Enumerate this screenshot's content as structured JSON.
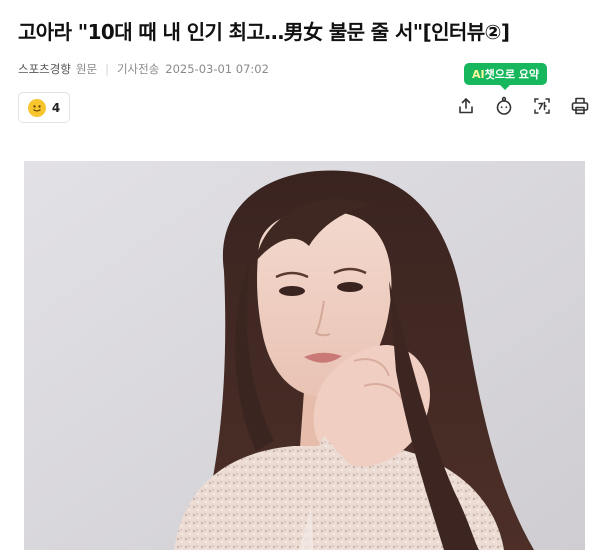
{
  "article": {
    "headline": "고아라 \"10대 때 내 인기 최고…男女 불문 줄 서\"[인터뷰②]",
    "press": "스포츠경향",
    "original_label": "원문",
    "published_label": "기사전송",
    "published_time": "2025-03-01 07:02"
  },
  "tooltip": {
    "ai_text": "AI",
    "rest_text": "챗으로 요약"
  },
  "reaction": {
    "count": "4"
  },
  "toolbar": {
    "icons": [
      "share-icon",
      "ai-chat-icon",
      "text-size-icon",
      "print-icon"
    ]
  },
  "colors": {
    "tooltip_bg": "#17b75e",
    "reaction_emoji": "#f7c62f"
  }
}
